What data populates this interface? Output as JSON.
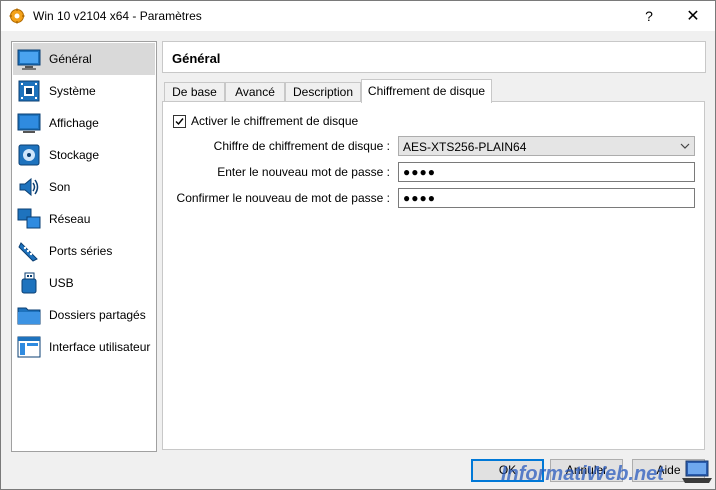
{
  "window": {
    "title": "Win 10 v2104 x64 - Paramètres",
    "help_label": "?",
    "close_label": "✕"
  },
  "sidebar": {
    "items": [
      {
        "label": "Général",
        "icon": "general-icon",
        "selected": true
      },
      {
        "label": "Système",
        "icon": "system-icon"
      },
      {
        "label": "Affichage",
        "icon": "display-icon"
      },
      {
        "label": "Stockage",
        "icon": "storage-icon"
      },
      {
        "label": "Son",
        "icon": "audio-icon"
      },
      {
        "label": "Réseau",
        "icon": "network-icon"
      },
      {
        "label": "Ports séries",
        "icon": "serial-ports-icon"
      },
      {
        "label": "USB",
        "icon": "usb-icon"
      },
      {
        "label": "Dossiers partagés",
        "icon": "shared-folders-icon"
      },
      {
        "label": "Interface utilisateur",
        "icon": "user-interface-icon"
      }
    ]
  },
  "page": {
    "title": "Général"
  },
  "tabs": [
    {
      "label": "De base"
    },
    {
      "label": "Avancé"
    },
    {
      "label": "Description"
    },
    {
      "label": "Chiffrement de disque",
      "active": true
    }
  ],
  "encryption": {
    "enable_label": "Activer le chiffrement de disque",
    "enable_checked": true,
    "cipher_label": "Chiffre de chiffrement de disque :",
    "cipher_value": "AES-XTS256-PLAIN64",
    "new_password_label": "Enter le nouveau mot de passe :",
    "new_password_value": "●●●●",
    "confirm_password_label": "Confirmer le nouveau de mot de passe :",
    "confirm_password_value": "●●●●"
  },
  "buttons": {
    "ok": "OK",
    "cancel": "Annuler",
    "help": "Aide"
  },
  "watermark": "InformatiWeb.net",
  "colors": {
    "selection": "#d9d9d9",
    "default_button_border": "#0078d7",
    "icon_blue": "#1e73be"
  }
}
